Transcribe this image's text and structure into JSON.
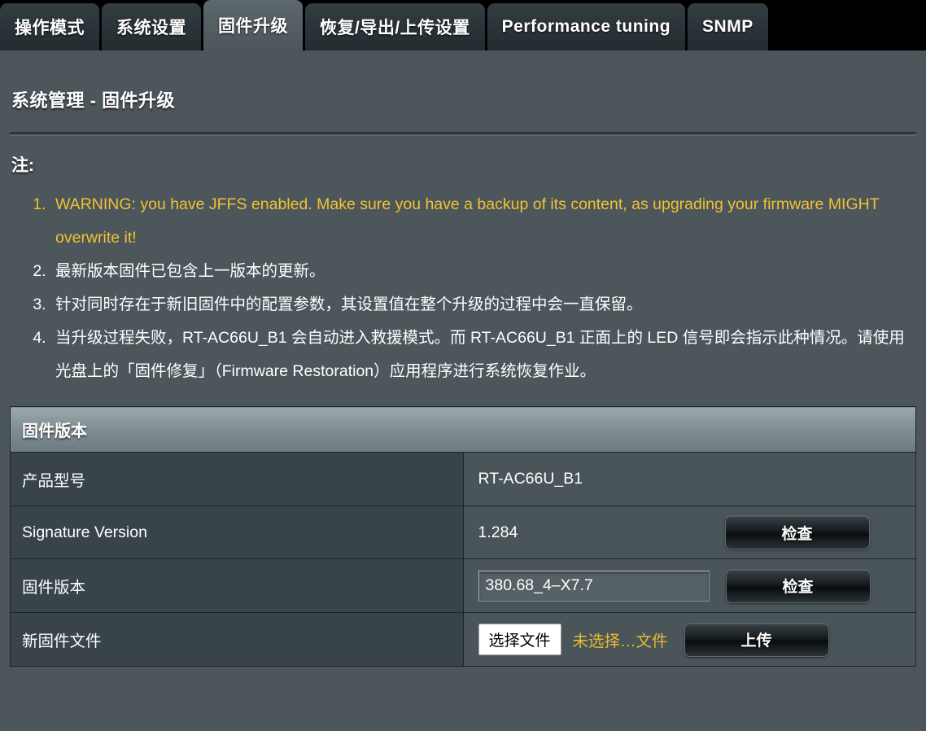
{
  "tabs": [
    {
      "label": "操作模式",
      "active": false,
      "latin": false
    },
    {
      "label": "系统设置",
      "active": false,
      "latin": false
    },
    {
      "label": "固件升级",
      "active": true,
      "latin": false
    },
    {
      "label": "恢复/导出/上传设置",
      "active": false,
      "latin": false
    },
    {
      "label": "Performance tuning",
      "active": false,
      "latin": true
    },
    {
      "label": "SNMP",
      "active": false,
      "latin": true
    }
  ],
  "page": {
    "title": "系统管理 - 固件升级",
    "note_heading": "注:"
  },
  "notes": [
    {
      "text": "WARNING: you have JFFS enabled. Make sure you have a backup of its content, as upgrading your firmware MIGHT overwrite it!",
      "warning": true
    },
    {
      "text": "最新版本固件已包含上一版本的更新。",
      "warning": false
    },
    {
      "text": "针对同时存在于新旧固件中的配置参数，其设置值在整个升级的过程中会一直保留。",
      "warning": false
    },
    {
      "text": "当升级过程失败，RT-AC66U_B1 会自动进入救援模式。而 RT-AC66U_B1 正面上的 LED 信号即会指示此种情况。请使用光盘上的「固件修复」（Firmware Restoration）应用程序进行系统恢复作业。",
      "warning": false
    }
  ],
  "table": {
    "section_title": "固件版本",
    "rows": {
      "product_model": {
        "label": "产品型号",
        "value": "RT-AC66U_B1"
      },
      "signature_version": {
        "label": "Signature Version",
        "value": "1.284",
        "button": "检查"
      },
      "firmware_version": {
        "label": "固件版本",
        "value": "380.68_4–X7.7",
        "button": "检查"
      },
      "new_firmware_file": {
        "label": "新固件文件",
        "choose_button": "选择文件",
        "file_status": "未选择…文件",
        "upload_button": "上传"
      }
    }
  },
  "colors": {
    "tabbar_bg": "#000000",
    "content_bg": "#4c565b",
    "active_tab_bg": "#545f64",
    "inactive_tab_bg": "#2a3338",
    "warning_text": "#f0c233",
    "label_cell_bg": "#39444a",
    "value_cell_bg": "#4a5559",
    "section_header_bg": "#7e8c91",
    "file_status_text": "#e8bb33"
  }
}
